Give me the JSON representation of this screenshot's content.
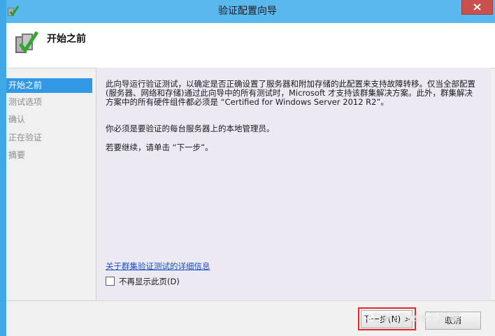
{
  "window": {
    "title": "验证配置向导"
  },
  "header": {
    "title": "开始之前"
  },
  "sidebar": {
    "steps": [
      {
        "label": "开始之前"
      },
      {
        "label": "测试选项"
      },
      {
        "label": "确认"
      },
      {
        "label": "正在验证"
      },
      {
        "label": "摘要"
      }
    ],
    "active_index": 0
  },
  "content": {
    "paragraph1": "此向导运行验证测试，以确定是否正确设置了服务器和附加存储的此配置来支持故障转移。仅当全部配置(服务器、网络和存储)通过此向导中的所有测试时，Microsoft 才支持该群集解决方案。此外，群集解决方案中的所有硬件组件都必须是 “Certified for Windows Server 2012 R2”。",
    "paragraph2": "你必须是要验证的每台服务器上的本地管理员。",
    "paragraph3": "若要继续，请单击 “下一步”。",
    "details_link": "关于群集验证测试的详细信息",
    "dont_show_label": "不再显示此页(D)",
    "dont_show_checked": false
  },
  "buttons": {
    "next_label": "下一步(N) >",
    "cancel_label": "取消"
  },
  "watermark": {
    "text": "DataBase干货铺"
  },
  "colors": {
    "title_bar": "#5bb8ee",
    "selected_step": "#3399e6",
    "close_button": "#c9504c",
    "link": "#1a4ec0",
    "highlight_box": "#e2272d"
  }
}
